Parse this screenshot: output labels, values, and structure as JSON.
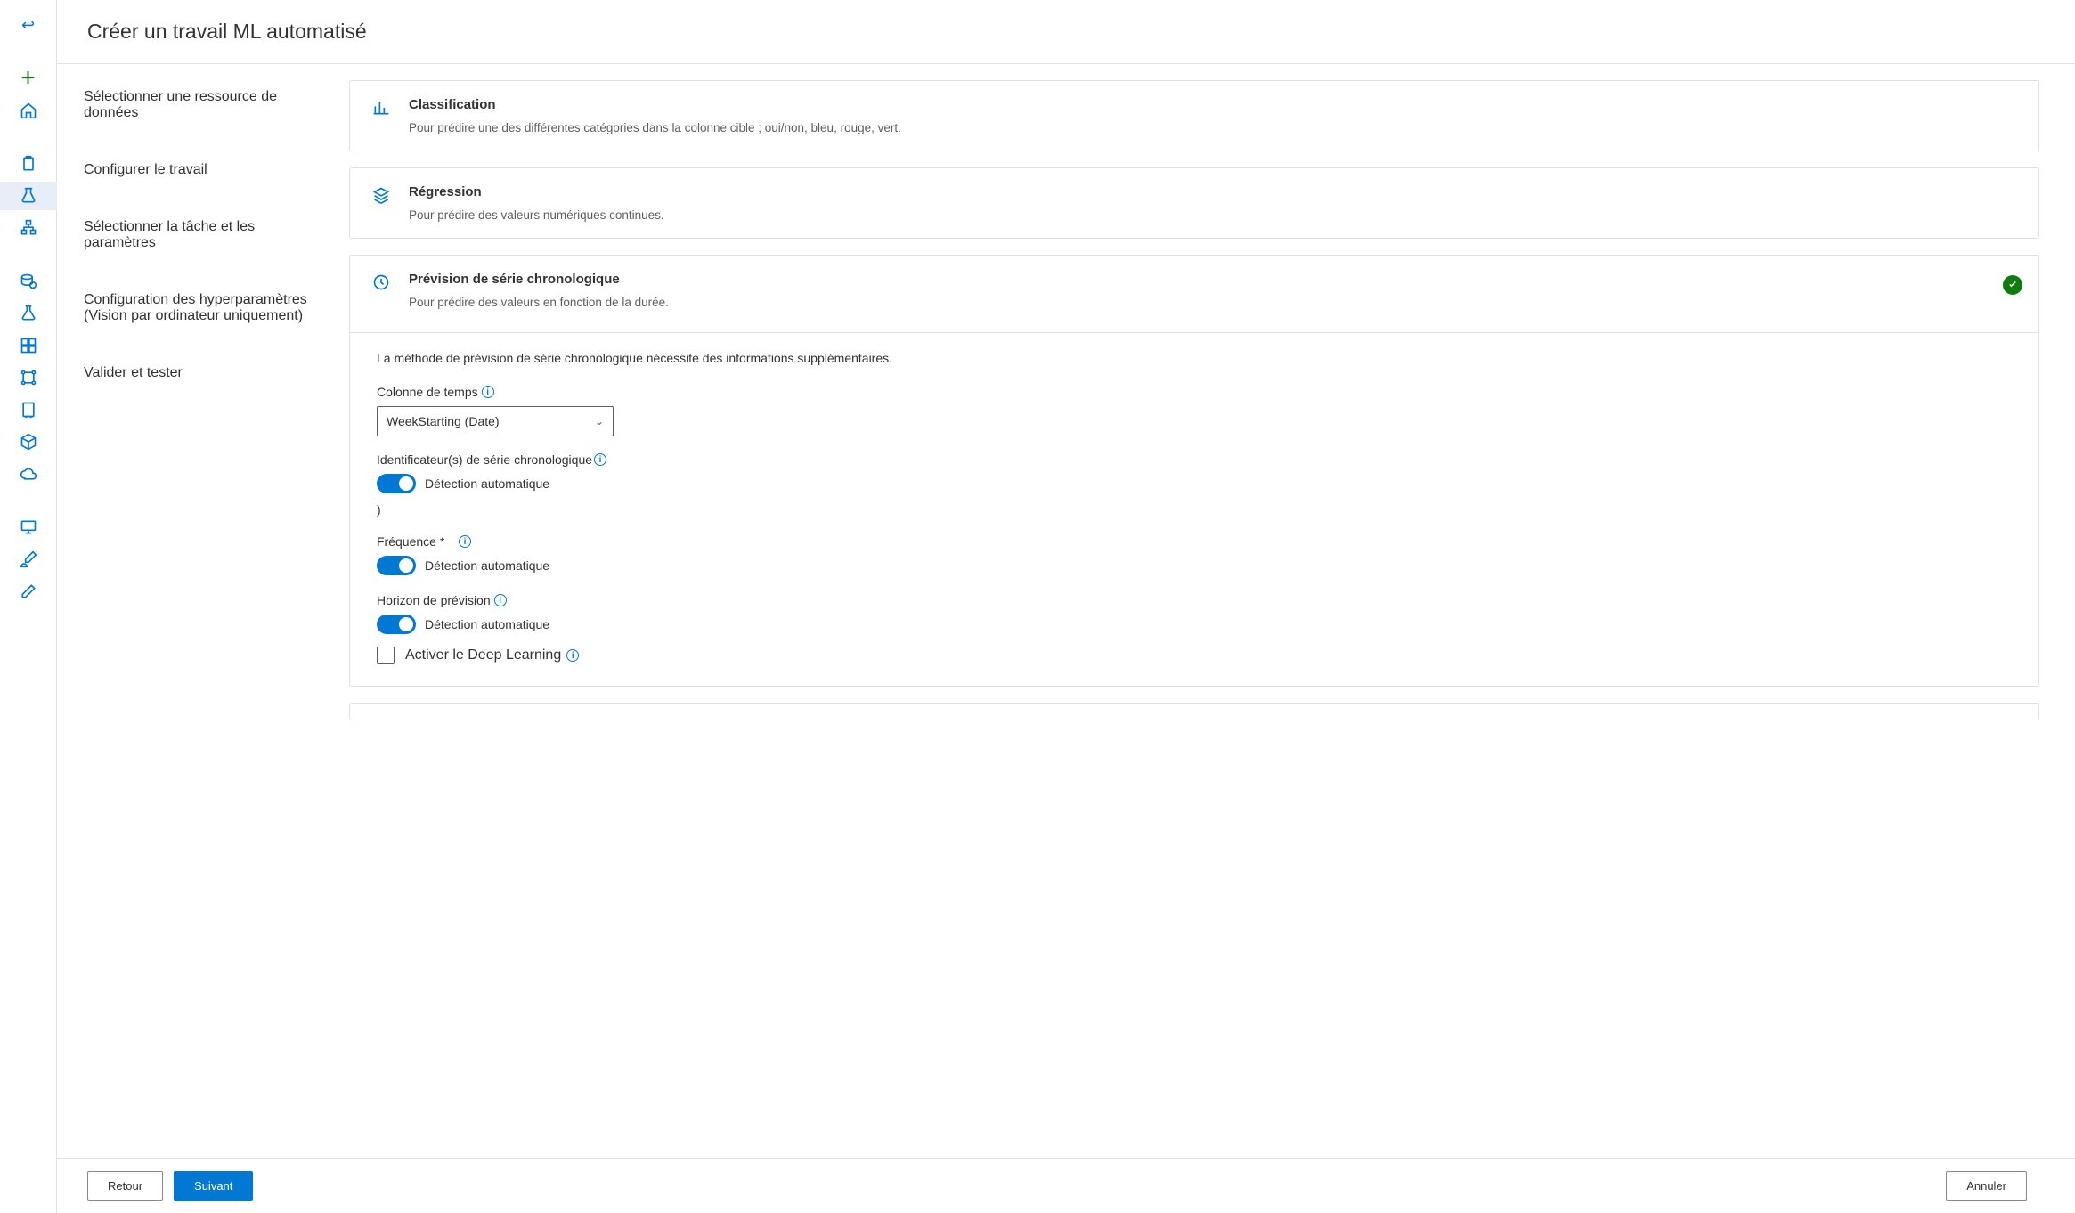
{
  "header": {
    "title": "Créer un travail ML automatisé"
  },
  "rail": {
    "icons": [
      "back-icon",
      "add-icon",
      "home-icon",
      "clipboard-icon",
      "flask-variant-icon",
      "sitemap-icon",
      "data-icon",
      "beaker-icon",
      "components-icon",
      "pipeline-icon",
      "compute-icon",
      "cube-icon",
      "cloud-icon",
      "monitor-icon",
      "paintbrush-icon",
      "edit-icon"
    ]
  },
  "wizard": {
    "steps": [
      {
        "label": "Sélectionner une ressource de données",
        "state": "done"
      },
      {
        "label": "Configurer le travail",
        "state": "done"
      },
      {
        "label": "Sélectionner la tâche et les paramètres",
        "state": "current"
      },
      {
        "label": "Configuration des hyperparamètres (Vision par ordinateur uniquement)",
        "state": "future"
      },
      {
        "label": "Valider et tester",
        "state": "future"
      }
    ]
  },
  "tasks": {
    "classification": {
      "title": "Classification",
      "desc": "Pour prédire une des différentes catégories dans la colonne cible ; oui/non, bleu, rouge, vert."
    },
    "regression": {
      "title": "Régression",
      "desc": "Pour prédire des valeurs numériques continues."
    },
    "forecast": {
      "title": "Prévision de série chronologique",
      "desc": "Pour prédire des valeurs en fonction de la durée.",
      "helper": "La méthode de prévision de série chronologique nécessite des informations supplémentaires.",
      "fields": {
        "time_col_label": "Colonne de temps",
        "time_col_value": "WeekStarting (Date)",
        "series_id_label": "Identificateur(s) de série chronologique",
        "auto_detect": "Détection automatique",
        "stray_paren": ")",
        "frequency_label": "Fréquence *",
        "horizon_label": "Horizon de prévision",
        "deep_learning_label": "Activer le Deep Learning"
      }
    }
  },
  "footer": {
    "back": "Retour",
    "next": "Suivant",
    "cancel": "Annuler"
  }
}
